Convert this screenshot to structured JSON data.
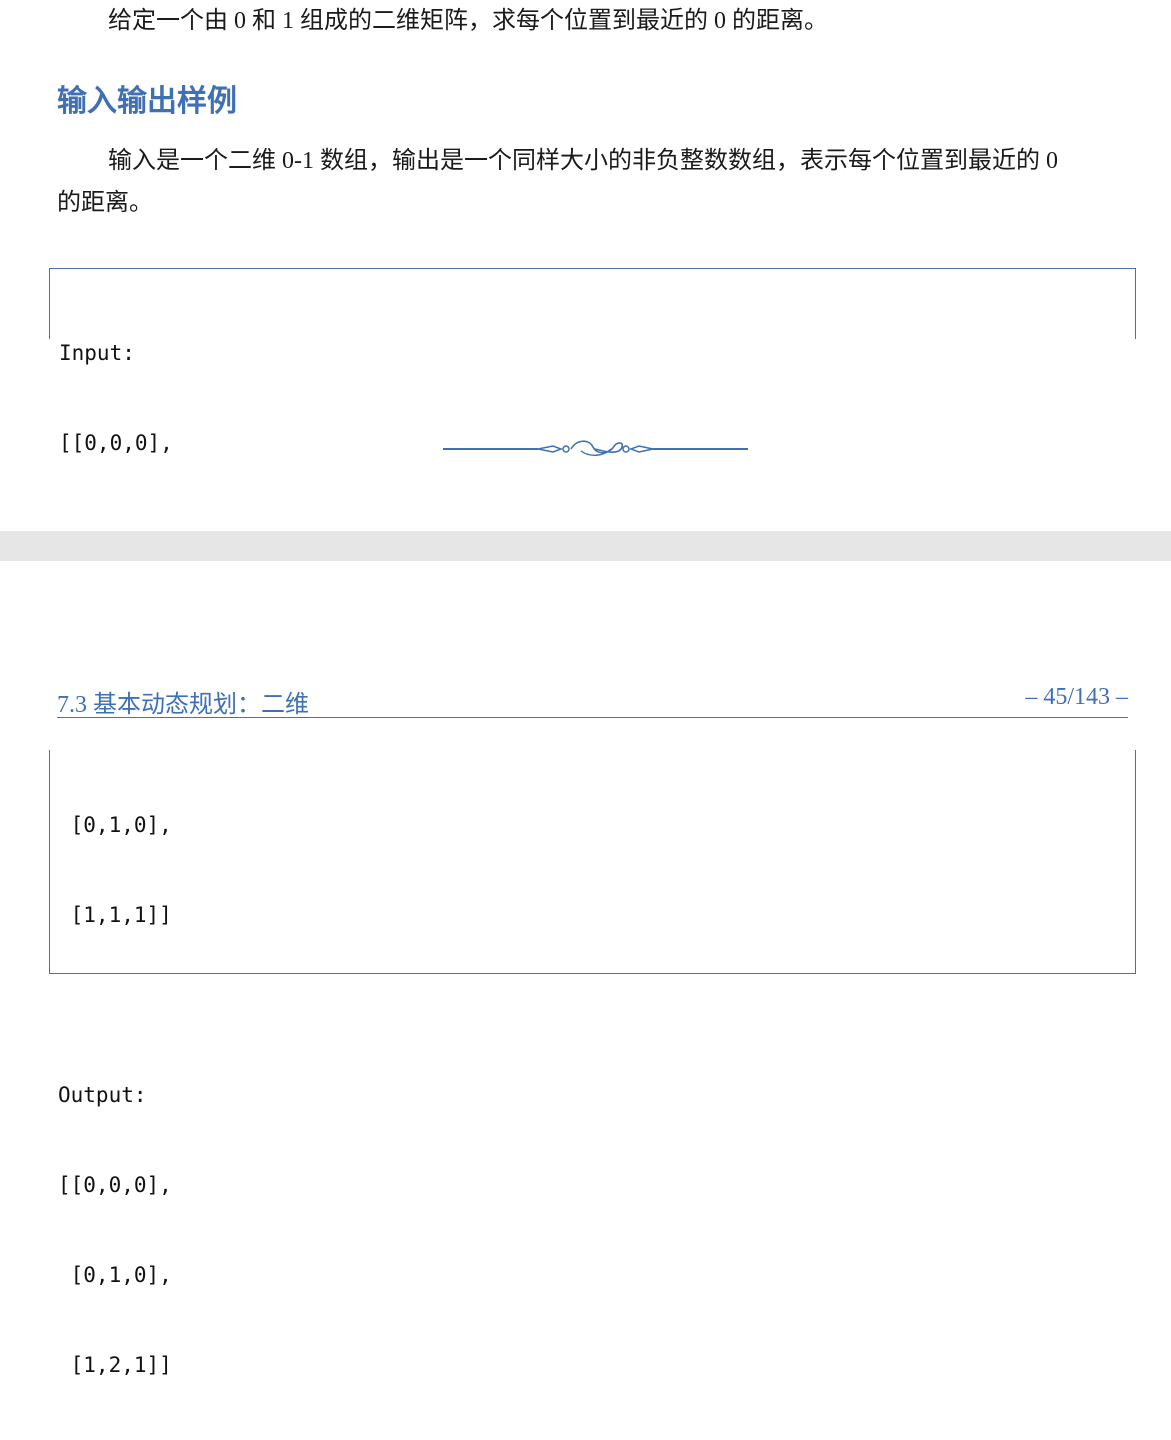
{
  "page_top": {
    "intro": "给定一个由 0 和 1 组成的二维矩阵，求每个位置到最近的 0 的距离。",
    "heading": "输入输出样例",
    "io_line1": "输入是一个二维 0-1 数组，输出是一个同样大小的非负整数数组，表示每个位置到最近的 0",
    "io_line2": "的距离。",
    "code_lines": [
      "Input:",
      "[[0,0,0],"
    ]
  },
  "page_bottom": {
    "running_head": {
      "section": "7.3 基本动态规划：二维",
      "page_number": "– 45/143 –"
    },
    "code_lines": [
      " [0,1,0],",
      " [1,1,1]]",
      "",
      "Output:",
      "[[0,0,0],",
      " [0,1,0],",
      " [1,2,1]]"
    ]
  },
  "colors": {
    "accent": "#3f6fb5",
    "frame": "#4b6fae",
    "page_gap": "#e6e6e6"
  }
}
